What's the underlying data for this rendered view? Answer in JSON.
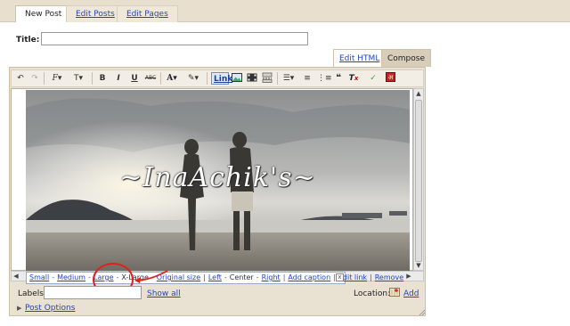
{
  "tabs": [
    {
      "label": "New Post"
    },
    {
      "label": "Edit Posts"
    },
    {
      "label": "Edit Pages"
    }
  ],
  "title_field": {
    "label": "Title:",
    "value": ""
  },
  "mode_tabs": {
    "edit_html": "Edit HTML",
    "compose": "Compose"
  },
  "toolbar": {
    "undo": "undo-icon",
    "redo": "redo-icon",
    "font_label": "F",
    "font_size_label": "T",
    "bold": "B",
    "italic": "I",
    "underline": "U",
    "strike": "ABC",
    "text_color": "A",
    "link_label": "Link"
  },
  "editor": {
    "watermark": "~InaAchik's~"
  },
  "image_popup": {
    "small": "Small",
    "medium": "Medium",
    "large": "Large",
    "xlarge": "X-Large",
    "original": "Original size",
    "left": "Left",
    "center": "Center",
    "right": "Right",
    "add_caption": "Add caption",
    "edit_link": "Edit link",
    "remove": "Remove",
    "close": "x"
  },
  "labels": {
    "label": "Labels:",
    "value": "",
    "show_all": "Show all"
  },
  "location": {
    "label": "Location:",
    "add": "Add"
  },
  "post_options": {
    "label": "Post Options"
  },
  "colors": {
    "accent_link": "#2244cc",
    "frame": "#e9e1d2",
    "annotation": "#e0201c"
  }
}
